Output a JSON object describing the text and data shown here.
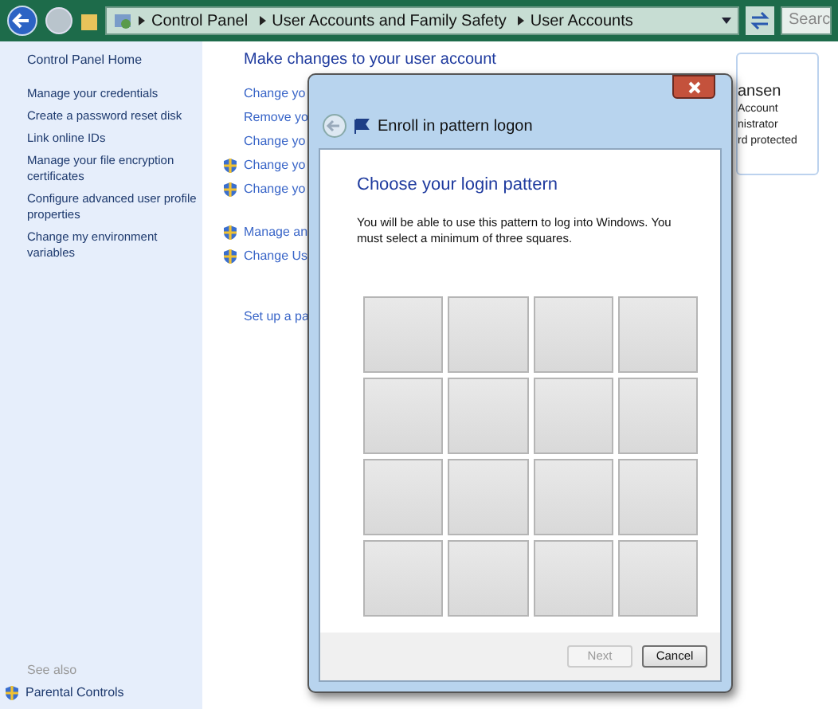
{
  "address_bar": {
    "breadcrumbs": [
      "Control Panel",
      "User Accounts and Family Safety",
      "User Accounts"
    ],
    "search_placeholder": "Searc"
  },
  "sidebar": {
    "home": "Control Panel Home",
    "items": [
      "Manage your credentials",
      "Create a password reset disk",
      "Link online IDs",
      "Manage your file encryption certificates",
      "Configure advanced user profile properties",
      "Change my environment variables"
    ],
    "see_also_heading": "See also",
    "see_also": [
      {
        "label": "Parental Controls",
        "shield": true
      }
    ]
  },
  "main": {
    "heading": "Make changes to your user account",
    "links": [
      {
        "label": "Change yo",
        "shield": false
      },
      {
        "label": "Remove yo",
        "shield": false
      },
      {
        "label": "Change yo",
        "shield": false
      },
      {
        "label": "Change yo",
        "shield": true
      },
      {
        "label": "Change yo",
        "shield": true
      }
    ],
    "links_2": [
      {
        "label": "Manage an",
        "shield": true
      },
      {
        "label": "Change Us",
        "shield": true
      }
    ],
    "links_3": [
      {
        "label": "Set up a pa",
        "shield": false
      }
    ],
    "account_card": [
      "ansen",
      "Account",
      "nistrator",
      "rd protected"
    ]
  },
  "dialog": {
    "title": "Enroll in pattern logon",
    "heading": "Choose your login pattern",
    "description": "You will be able to use this pattern to log into Windows. You must select a minimum of three squares.",
    "grid": [
      [
        {
          "selected": false
        },
        {
          "selected": false
        },
        {
          "selected": false
        },
        {
          "selected": false
        }
      ],
      [
        {
          "selected": false
        },
        {
          "selected": false
        },
        {
          "selected": false
        },
        {
          "selected": false
        }
      ],
      [
        {
          "selected": false
        },
        {
          "selected": false
        },
        {
          "selected": false
        },
        {
          "selected": false
        }
      ],
      [
        {
          "selected": false
        },
        {
          "selected": false
        },
        {
          "selected": false
        },
        {
          "selected": false
        }
      ]
    ],
    "buttons": [
      {
        "label": "Next",
        "disabled": true
      },
      {
        "label": "Cancel",
        "disabled": false
      }
    ]
  }
}
